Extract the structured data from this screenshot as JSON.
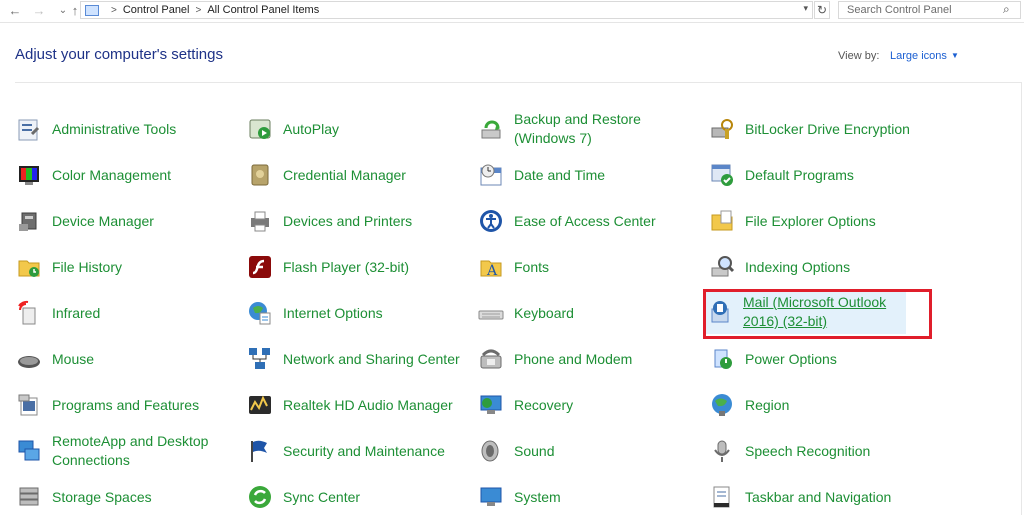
{
  "nav": {
    "back": "←",
    "forward": "→",
    "recent": "⌄",
    "up": "↑"
  },
  "breadcrumb": {
    "crumb1": "Control Panel",
    "crumb2": "All Control Panel Items"
  },
  "search": {
    "placeholder": "Search Control Panel"
  },
  "header": {
    "title": "Adjust your computer's settings",
    "view_by_label": "View by:",
    "view_by_value": "Large icons"
  },
  "items": [
    {
      "label": "Administrative Tools",
      "icon": "admin-tools-icon"
    },
    {
      "label": "AutoPlay",
      "icon": "autoplay-icon"
    },
    {
      "label": "Backup and Restore (Windows 7)",
      "icon": "backup-icon"
    },
    {
      "label": "BitLocker Drive Encryption",
      "icon": "bitlocker-icon"
    },
    {
      "label": "Color Management",
      "icon": "color-management-icon"
    },
    {
      "label": "Credential Manager",
      "icon": "credential-manager-icon"
    },
    {
      "label": "Date and Time",
      "icon": "date-time-icon"
    },
    {
      "label": "Default Programs",
      "icon": "default-programs-icon"
    },
    {
      "label": "Device Manager",
      "icon": "device-manager-icon"
    },
    {
      "label": "Devices and Printers",
      "icon": "printer-icon"
    },
    {
      "label": "Ease of Access Center",
      "icon": "ease-of-access-icon"
    },
    {
      "label": "File Explorer Options",
      "icon": "folder-icon"
    },
    {
      "label": "File History",
      "icon": "file-history-icon"
    },
    {
      "label": "Flash Player (32-bit)",
      "icon": "flash-icon"
    },
    {
      "label": "Fonts",
      "icon": "fonts-icon"
    },
    {
      "label": "Indexing Options",
      "icon": "indexing-icon"
    },
    {
      "label": "Infrared",
      "icon": "infrared-icon"
    },
    {
      "label": "Internet Options",
      "icon": "internet-options-icon"
    },
    {
      "label": "Keyboard",
      "icon": "keyboard-icon"
    },
    {
      "label": "Mail (Microsoft Outlook 2016) (32-bit)",
      "icon": "mail-icon",
      "selected": true
    },
    {
      "label": "Mouse",
      "icon": "mouse-icon"
    },
    {
      "label": "Network and Sharing Center",
      "icon": "network-icon"
    },
    {
      "label": "Phone and Modem",
      "icon": "phone-icon"
    },
    {
      "label": "Power Options",
      "icon": "power-icon"
    },
    {
      "label": "Programs and Features",
      "icon": "programs-icon"
    },
    {
      "label": "Realtek HD Audio Manager",
      "icon": "audio-manager-icon"
    },
    {
      "label": "Recovery",
      "icon": "recovery-icon"
    },
    {
      "label": "Region",
      "icon": "region-icon"
    },
    {
      "label": "RemoteApp and Desktop Connections",
      "icon": "remote-desktop-icon"
    },
    {
      "label": "Security and Maintenance",
      "icon": "flag-icon"
    },
    {
      "label": "Sound",
      "icon": "speaker-icon"
    },
    {
      "label": "Speech Recognition",
      "icon": "microphone-icon"
    },
    {
      "label": "Storage Spaces",
      "icon": "storage-icon"
    },
    {
      "label": "Sync Center",
      "icon": "sync-icon"
    },
    {
      "label": "System",
      "icon": "system-icon"
    },
    {
      "label": "Taskbar and Navigation",
      "icon": "taskbar-icon"
    }
  ]
}
